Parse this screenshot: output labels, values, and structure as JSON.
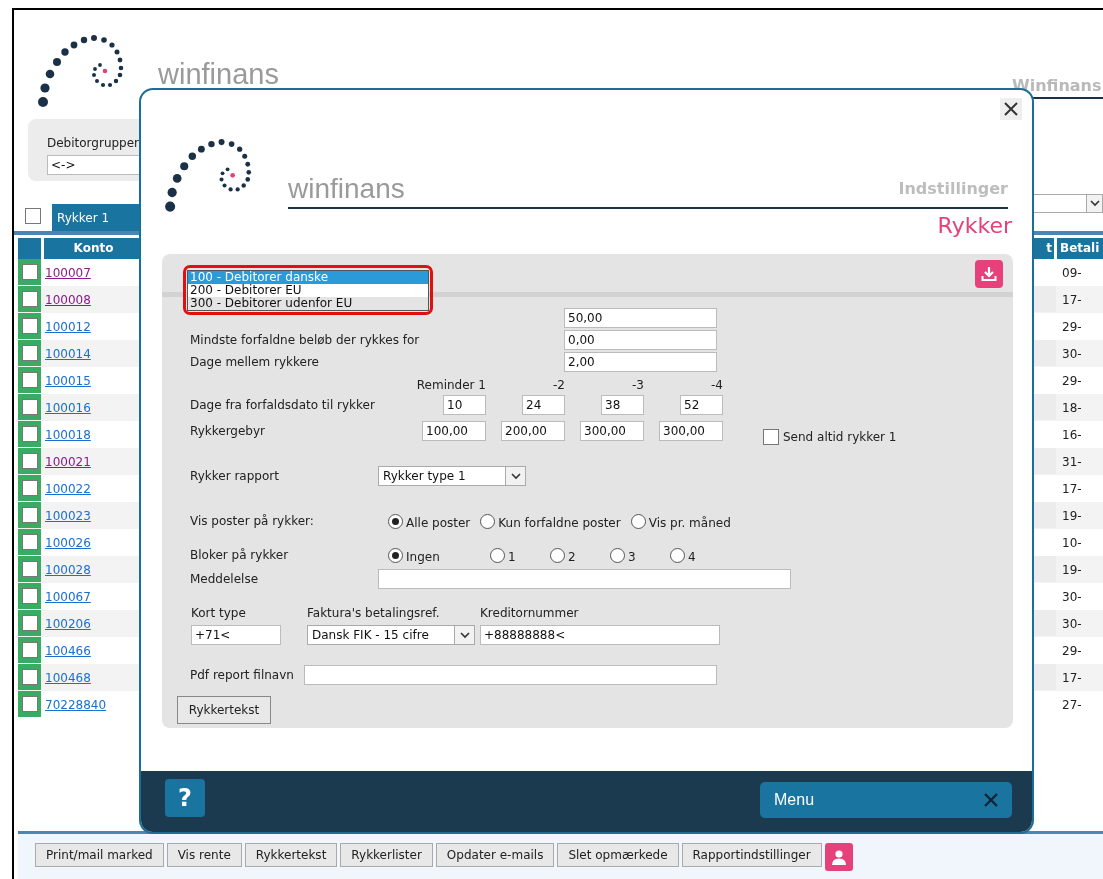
{
  "app": {
    "logo_text": "winfinans",
    "brand_right": "Winfinans"
  },
  "filter": {
    "label": "Debitorgrupper",
    "value": "<->"
  },
  "tab": {
    "label": "Rykker 1",
    "checked": false,
    "selected": true
  },
  "table": {
    "columns": [
      "Konto",
      "t",
      "Betali"
    ],
    "rows": [
      {
        "konto": "100007",
        "visited": true,
        "checked": false,
        "column_3": "09-"
      },
      {
        "konto": "100008",
        "visited": true,
        "checked": false,
        "column_3": "17-"
      },
      {
        "konto": "100012",
        "visited": false,
        "checked": false,
        "column_3": "29-"
      },
      {
        "konto": "100014",
        "visited": false,
        "checked": false,
        "column_3": "30-"
      },
      {
        "konto": "100015",
        "visited": false,
        "checked": false,
        "column_3": "29-"
      },
      {
        "konto": "100016",
        "visited": false,
        "checked": false,
        "column_3": "18-"
      },
      {
        "konto": "100018",
        "visited": false,
        "checked": false,
        "column_3": "16-"
      },
      {
        "konto": "100021",
        "visited": true,
        "checked": false,
        "column_3": "31-"
      },
      {
        "konto": "100022",
        "visited": false,
        "checked": false,
        "column_3": "17-"
      },
      {
        "konto": "100023",
        "visited": false,
        "checked": false,
        "column_3": "19-"
      },
      {
        "konto": "100026",
        "visited": false,
        "checked": false,
        "column_3": "10-"
      },
      {
        "konto": "100028",
        "visited": false,
        "checked": false,
        "column_3": "19-"
      },
      {
        "konto": "100067",
        "visited": false,
        "checked": false,
        "column_3": "30-"
      },
      {
        "konto": "100206",
        "visited": false,
        "checked": false,
        "column_3": "30-"
      },
      {
        "konto": "100466",
        "visited": false,
        "checked": false,
        "column_3": "29-"
      },
      {
        "konto": "100468",
        "visited": false,
        "checked": false,
        "column_3": "17-"
      },
      {
        "konto": "70228840",
        "visited": false,
        "checked": false,
        "column_3": "27-"
      }
    ]
  },
  "dialog": {
    "logo_text": "winfinans",
    "section": "Indstillinger",
    "title": "Rykker",
    "group_list": [
      {
        "label": "100 - Debitorer danske",
        "selected": true
      },
      {
        "label": "200 - Debitorer EU",
        "selected": false
      },
      {
        "label": "300 - Debitorer udenfor EU",
        "selected": false
      }
    ],
    "fields": [
      {
        "value": "50,00"
      },
      {
        "label": "Mindste forfaldne beløb der rykkes for",
        "value": "0,00"
      },
      {
        "label": "Dage mellem rykkere",
        "value": "2,00"
      }
    ],
    "reminder_headers": [
      "Reminder 1",
      "-2",
      "-3",
      "-4"
    ],
    "reminder_rows": [
      {
        "label": "Dage fra forfaldsdato til rykker",
        "values": [
          "10",
          "24",
          "38",
          "52"
        ]
      },
      {
        "label": "Rykkergebyr",
        "values": [
          "100,00",
          "200,00",
          "300,00",
          "300,00"
        ]
      }
    ],
    "send_always": {
      "label": "Send altid rykker 1",
      "checked": false
    },
    "report": {
      "label": "Rykker rapport",
      "value": "Rykker type 1"
    },
    "radio_groups": [
      {
        "label": "Vis poster på rykker:",
        "options": [
          {
            "label": "Alle poster",
            "selected": true
          },
          {
            "label": "Kun forfaldne poster",
            "selected": false
          },
          {
            "label": "Vis pr. måned",
            "selected": false
          }
        ]
      },
      {
        "label": "Bloker på rykker",
        "options": [
          {
            "label": "Ingen",
            "selected": true
          },
          {
            "label": "1",
            "selected": false
          },
          {
            "label": "2",
            "selected": false
          },
          {
            "label": "3",
            "selected": false
          },
          {
            "label": "4",
            "selected": false
          }
        ]
      }
    ],
    "message": {
      "label": "Meddelelse"
    },
    "card_type": {
      "label": "Kort type",
      "value": "+71<"
    },
    "payment_ref": {
      "label": "Faktura's betalingsref.",
      "value": "Dansk FIK - 15 cifre"
    },
    "creditor": {
      "label": "Kreditornummer",
      "value": "+88888888<"
    },
    "pdf": {
      "label": "Pdf report filnavn"
    },
    "text_button": "Rykkertekst",
    "help": "?",
    "menu": "Menu"
  },
  "toolbar": [
    "Print/mail marked",
    "Vis rente",
    "Rykkertekst",
    "Rykkerlister",
    "Opdater e-mails",
    "Slet opmærkede",
    "Rapportindstillinger"
  ]
}
